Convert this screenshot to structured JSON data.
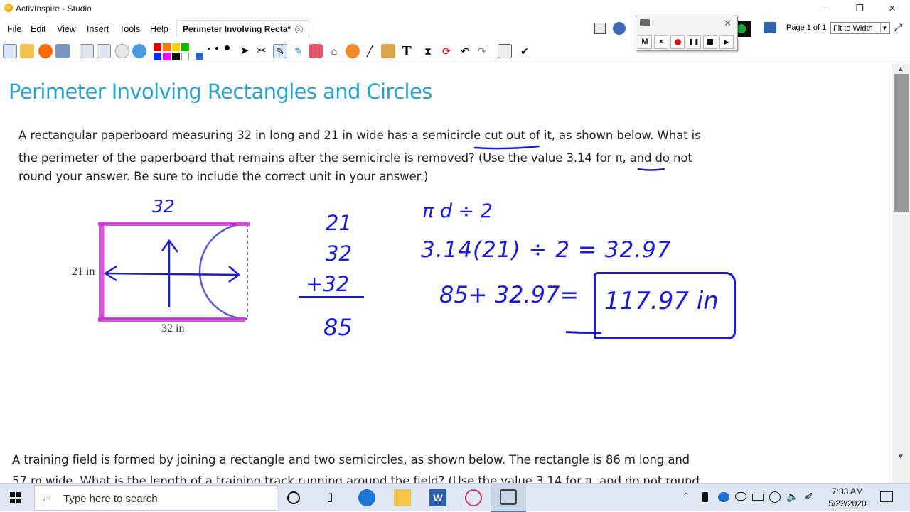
{
  "window": {
    "title": "ActivInspire - Studio",
    "minimize": "–",
    "restore": "❐",
    "close": "✕"
  },
  "menu": {
    "items": [
      "File",
      "Edit",
      "View",
      "Insert",
      "Tools",
      "Help"
    ],
    "doc_tab": "Perimeter Involving Recta*",
    "tab_close": "×"
  },
  "page_nav": {
    "page_label": "Page 1 of 1",
    "zoom_value": "Fit to Width"
  },
  "recorder": {
    "m_label": "M",
    "x_label": "×"
  },
  "colors": {
    "accent_title": "#27a3d1",
    "ink": "#1a1adb",
    "highlight": "#d236d8"
  },
  "palette": [
    "#e00000",
    "#ffd000",
    "#00a000",
    "#00c000",
    "#0030ff",
    "#ff00ff",
    "#111111",
    "#ffffff"
  ],
  "slide": {
    "title": "Perimeter Involving Rectangles and Circles",
    "problem1": {
      "line1": "A rectangular paperboard measuring 32 in long and 21 in wide has a semicircle cut out of it, as shown below. What is",
      "line2": "the perimeter of the paperboard that remains after the semicircle is removed? (Use the value 3.14 for π, and do not",
      "line3": "round your answer. Be sure to include the correct unit in your answer.)"
    },
    "figure": {
      "width_label": "21 in",
      "length_label": "32 in"
    },
    "handwriting": {
      "top_label": "32",
      "sum_lines": [
        "21",
        "32",
        "+32",
        "85"
      ],
      "formula": "π d ÷ 2",
      "calc": "3.14(21) ÷ 2 = 32.97",
      "total": "85+ 32.97=",
      "answer": "117.97 in"
    },
    "problem2": {
      "line1": "A training field is formed by joining a rectangle and two semicircles, as shown below. The rectangle is 86 m long and",
      "line2": "57 m wide. What is the length of a training track running around the field? (Use the value 3.14 for π, and do not round"
    }
  },
  "taskbar": {
    "search_placeholder": "Type here to search",
    "time": "7:33 AM",
    "date": "5/22/2020"
  }
}
